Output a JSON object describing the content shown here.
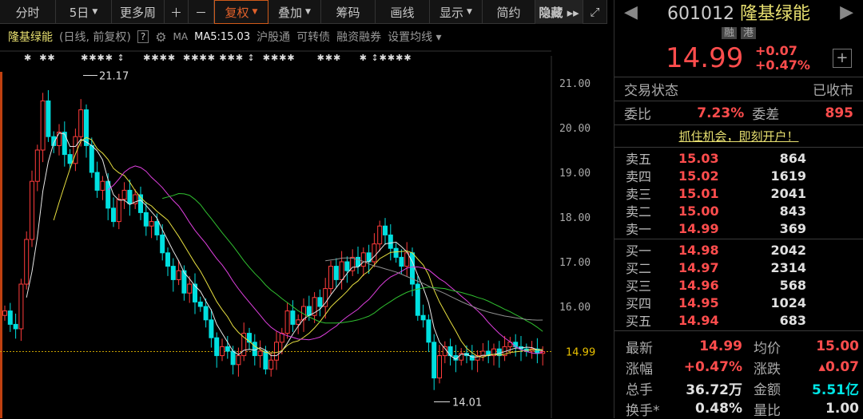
{
  "toolbar": {
    "items": [
      {
        "label": "分时",
        "w": 70
      },
      {
        "label": "5日",
        "w": 70,
        "arrow": true
      },
      {
        "label": "更多周",
        "w": 66
      },
      {
        "label": "＋",
        "w": 30
      },
      {
        "label": "－",
        "w": 32
      },
      {
        "label": "复权",
        "w": 68,
        "arrow": true,
        "active": true
      },
      {
        "label": "叠加",
        "w": 66,
        "arrow": true
      },
      {
        "label": "筹码",
        "w": 68
      },
      {
        "label": "画线",
        "w": 68
      },
      {
        "label": "显示",
        "w": 66,
        "arrow": true
      },
      {
        "label": "简约",
        "w": 66
      },
      {
        "label": "隐藏 ▸▸",
        "w": 60,
        "hide": true
      },
      {
        "label": "⤢",
        "w": 30
      }
    ]
  },
  "info": {
    "name": "隆基绿能",
    "period": "(日线, 前复权)",
    "help": "?",
    "ma": "MA",
    "ma5": "MA5:15.03",
    "hgt": "沪股通",
    "cb": "可转债",
    "margin": "融资融券",
    "set_ma": "设置均线 ▾"
  },
  "masked_row": "✱  ✱✱       ✱✱✱✱ ↕     ✱✱✱✱  ✱✱✱✱ ✱✱✱ ↕  ✱✱✱✱      ✱✱✱     ✱ ↕✱✱✱✱",
  "chart_data": {
    "type": "candlestick",
    "ylim": [
      13.6,
      22.0
    ],
    "y_ticks": [
      "21.00",
      "20.00",
      "19.00",
      "18.00",
      "17.00",
      "16.00"
    ],
    "last_price": "14.99",
    "high_label": "21.17",
    "low_label": "14.01",
    "closes": [
      15.9,
      15.6,
      15.5,
      16.5,
      17.5,
      18.8,
      19.5,
      20.6,
      19.8,
      19.6,
      19.9,
      19.4,
      19.2,
      19.8,
      20.4,
      19.6,
      19.0,
      18.6,
      18.8,
      18.2,
      17.9,
      18.4,
      18.6,
      18.3,
      18.5,
      18.1,
      17.8,
      17.9,
      17.6,
      17.2,
      16.9,
      16.6,
      16.8,
      16.3,
      16.5,
      16.1,
      16.0,
      15.7,
      15.3,
      14.9,
      15.1,
      15.0,
      14.7,
      14.9,
      15.4,
      15.2,
      14.9,
      15.0,
      14.6,
      14.8,
      15.2,
      15.4,
      15.9,
      15.6,
      15.7,
      16.0,
      15.8,
      16.2,
      16.0,
      16.4,
      16.9,
      16.6,
      17.0,
      16.8,
      17.1,
      16.9,
      17.2,
      17.0,
      17.4,
      17.8,
      17.6,
      17.3,
      17.1,
      16.9,
      17.2,
      16.5,
      15.8,
      15.7,
      15.2,
      14.4,
      14.9,
      15.1,
      14.9,
      14.8,
      14.95,
      14.9,
      14.8,
      14.9,
      15.0,
      14.9,
      15.05,
      14.9,
      15.1,
      15.2,
      15.1,
      15.05,
      15.0,
      15.05,
      14.95,
      14.99
    ],
    "ma_periods": [
      5,
      10,
      20,
      30,
      60
    ],
    "ma_colors": [
      "#e8e8e8",
      "#e8e040",
      "#e040e0",
      "#30c030",
      "#909090"
    ],
    "up_color": "#ff3b3b",
    "down_color": "#00e0e0"
  },
  "quote": {
    "code": "601012",
    "name": "隆基绿能",
    "tags": [
      "融",
      "港"
    ],
    "price": "14.99",
    "change": "+0.07",
    "pct": "+0.47%",
    "status_label": "交易状态",
    "status": "已收市",
    "wb_label": "委比",
    "wb": "7.23%",
    "wc_label": "委差",
    "wc": "895",
    "promo": "抓住机会，即刻开户！"
  },
  "sells": [
    {
      "l": "卖五",
      "p": "15.03",
      "v": "864"
    },
    {
      "l": "卖四",
      "p": "15.02",
      "v": "1619"
    },
    {
      "l": "卖三",
      "p": "15.01",
      "v": "2041"
    },
    {
      "l": "卖二",
      "p": "15.00",
      "v": "843"
    },
    {
      "l": "卖一",
      "p": "14.99",
      "v": "369"
    }
  ],
  "buys": [
    {
      "l": "买一",
      "p": "14.98",
      "v": "2042"
    },
    {
      "l": "买二",
      "p": "14.97",
      "v": "2314"
    },
    {
      "l": "买三",
      "p": "14.96",
      "v": "568"
    },
    {
      "l": "买四",
      "p": "14.95",
      "v": "1024"
    },
    {
      "l": "买五",
      "p": "14.94",
      "v": "683"
    }
  ],
  "stats": [
    {
      "k1": "最新",
      "v1": "14.99",
      "c1": "#ff4d4d",
      "k2": "均价",
      "v2": "15.00",
      "c2": "#ff4d4d"
    },
    {
      "k1": "涨幅",
      "v1": "+0.47%",
      "c1": "#ff4d4d",
      "k2": "涨跌",
      "v2": "▴0.07",
      "c2": "#ff4d4d"
    },
    {
      "k1": "总手",
      "v1": "36.72万",
      "c1": "#e0e0e0",
      "k2": "金额",
      "v2": "5.51亿",
      "c2": "#00e5e5"
    },
    {
      "k1": "换手*",
      "v1": "0.48%",
      "c1": "#e0e0e0",
      "k2": "量比",
      "v2": "1.00",
      "c2": "#e0e0e0"
    }
  ]
}
